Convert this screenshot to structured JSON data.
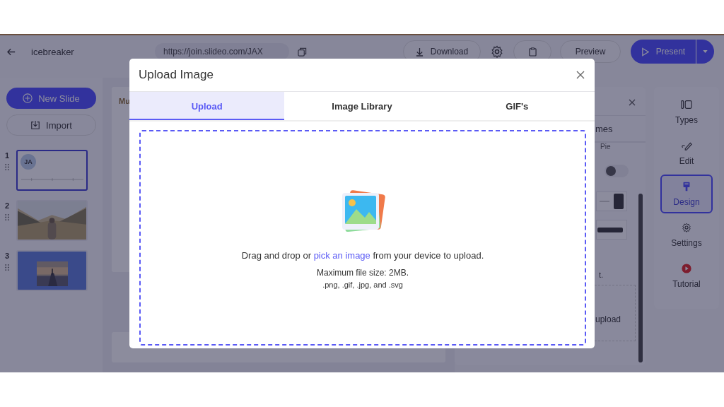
{
  "header": {
    "title": "icebreaker",
    "url": "https://join.slideo.com/JAX",
    "download": "Download",
    "preview": "Preview",
    "present": "Present"
  },
  "sidebar": {
    "new_slide": "New Slide",
    "import": "Import",
    "slides": [
      {
        "number": "1",
        "selected": true,
        "kind": "title",
        "avatar": "JA"
      },
      {
        "number": "2",
        "selected": false
      },
      {
        "number": "3",
        "selected": false,
        "kind": "photo-on-blue"
      }
    ]
  },
  "canvas": {
    "title": "Mu"
  },
  "design_panel": {
    "tab": "mes",
    "chart_label": "Pie",
    "toggle_on": false,
    "note": "t.",
    "upload": "upload"
  },
  "rail": [
    {
      "label": "Types",
      "selected": false
    },
    {
      "label": "Edit",
      "selected": false
    },
    {
      "label": "Design",
      "selected": true
    },
    {
      "label": "Settings",
      "selected": false
    },
    {
      "label": "Tutorial",
      "selected": false
    }
  ],
  "modal": {
    "title": "Upload Image",
    "tabs": [
      {
        "label": "Upload",
        "selected": true
      },
      {
        "label": "Image Library",
        "selected": false
      },
      {
        "label": "GIF's",
        "selected": false
      }
    ],
    "instruction": {
      "before": "Drag and drop or ",
      "link": "pick an image",
      "after": " from your device to upload."
    },
    "max_size": "Maximum file size: 2MB.",
    "formats": ".png, .gif, .jpg, and .svg"
  }
}
